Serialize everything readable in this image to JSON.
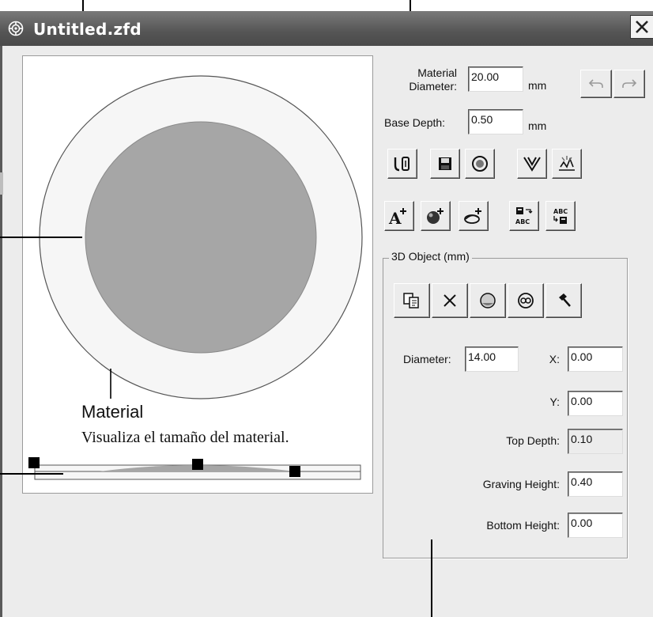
{
  "window": {
    "title": "Untitled.zfd"
  },
  "canvas": {
    "material_label": "Material",
    "material_description": "Visualiza el tamaño del material."
  },
  "settings": {
    "material_diameter_label_1": "Material",
    "material_diameter_label_2": "Diameter:",
    "material_diameter_value": "20.00",
    "material_diameter_unit": "mm",
    "base_depth_label": "Base Depth:",
    "base_depth_value": "0.50",
    "base_depth_unit": "mm"
  },
  "object": {
    "group_title": "3D Object (mm)",
    "diameter_label": "Diameter:",
    "diameter_value": "14.00",
    "x_label": "X:",
    "x_value": "0.00",
    "y_label": "Y:",
    "y_value": "0.00",
    "top_depth_label": "Top Depth:",
    "top_depth_value": "0.10",
    "graving_height_label": "Graving Height:",
    "graving_height_value": "0.40",
    "bottom_height_label": "Bottom Height:",
    "bottom_height_value": "0.00"
  },
  "icons": {
    "undo": "undo-icon",
    "redo": "redo-icon",
    "toolbar_row1": [
      "import-icon",
      "save-icon",
      "material-circle-icon",
      "v-shape-icon",
      "engrave-preview-icon"
    ],
    "toolbar_row2": [
      "add-text-icon",
      "add-sphere-icon",
      "add-shape-icon",
      "convert-to-text-icon",
      "convert-from-text-icon"
    ],
    "object_toolbar": [
      "copy-icon",
      "delete-icon",
      "sphere-icon",
      "ring-icon",
      "hammer-icon"
    ]
  },
  "colors": {
    "material": "#f6f6f6",
    "object": "#a6a6a6",
    "titlebar": "#555555",
    "window_bg": "#ececec"
  }
}
